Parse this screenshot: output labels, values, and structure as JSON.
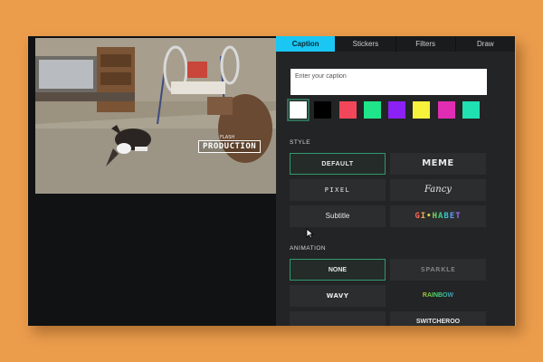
{
  "video": {
    "watermark_small": "FLASH",
    "watermark": "PRODUCTION"
  },
  "tabs": [
    {
      "label": "Caption",
      "active": true
    },
    {
      "label": "Stickers",
      "active": false
    },
    {
      "label": "Filters",
      "active": false
    },
    {
      "label": "Draw",
      "active": false
    }
  ],
  "caption": {
    "placeholder": "Enter your caption"
  },
  "colors": [
    {
      "name": "white",
      "hex": "#FFFFFF",
      "selected": true
    },
    {
      "name": "black",
      "hex": "#000000",
      "selected": false
    },
    {
      "name": "red",
      "hex": "#F2475A",
      "selected": false
    },
    {
      "name": "green",
      "hex": "#1FE58A",
      "selected": false
    },
    {
      "name": "purple",
      "hex": "#8B21F5",
      "selected": false
    },
    {
      "name": "yellow",
      "hex": "#F7F23B",
      "selected": false
    },
    {
      "name": "magenta",
      "hex": "#E02DB3",
      "selected": false
    },
    {
      "name": "teal",
      "hex": "#1FE1B2",
      "selected": false
    }
  ],
  "style": {
    "label": "STYLE",
    "options": [
      "DEFAULT",
      "MEME",
      "PIXEL",
      "Fancy",
      "Subtitle",
      "GI•HABET"
    ]
  },
  "animation": {
    "label": "ANIMATION",
    "options": [
      "NONE",
      "SPARKLE",
      "WAVY",
      "RAINBOW",
      "",
      "SWITCHEROO"
    ]
  }
}
